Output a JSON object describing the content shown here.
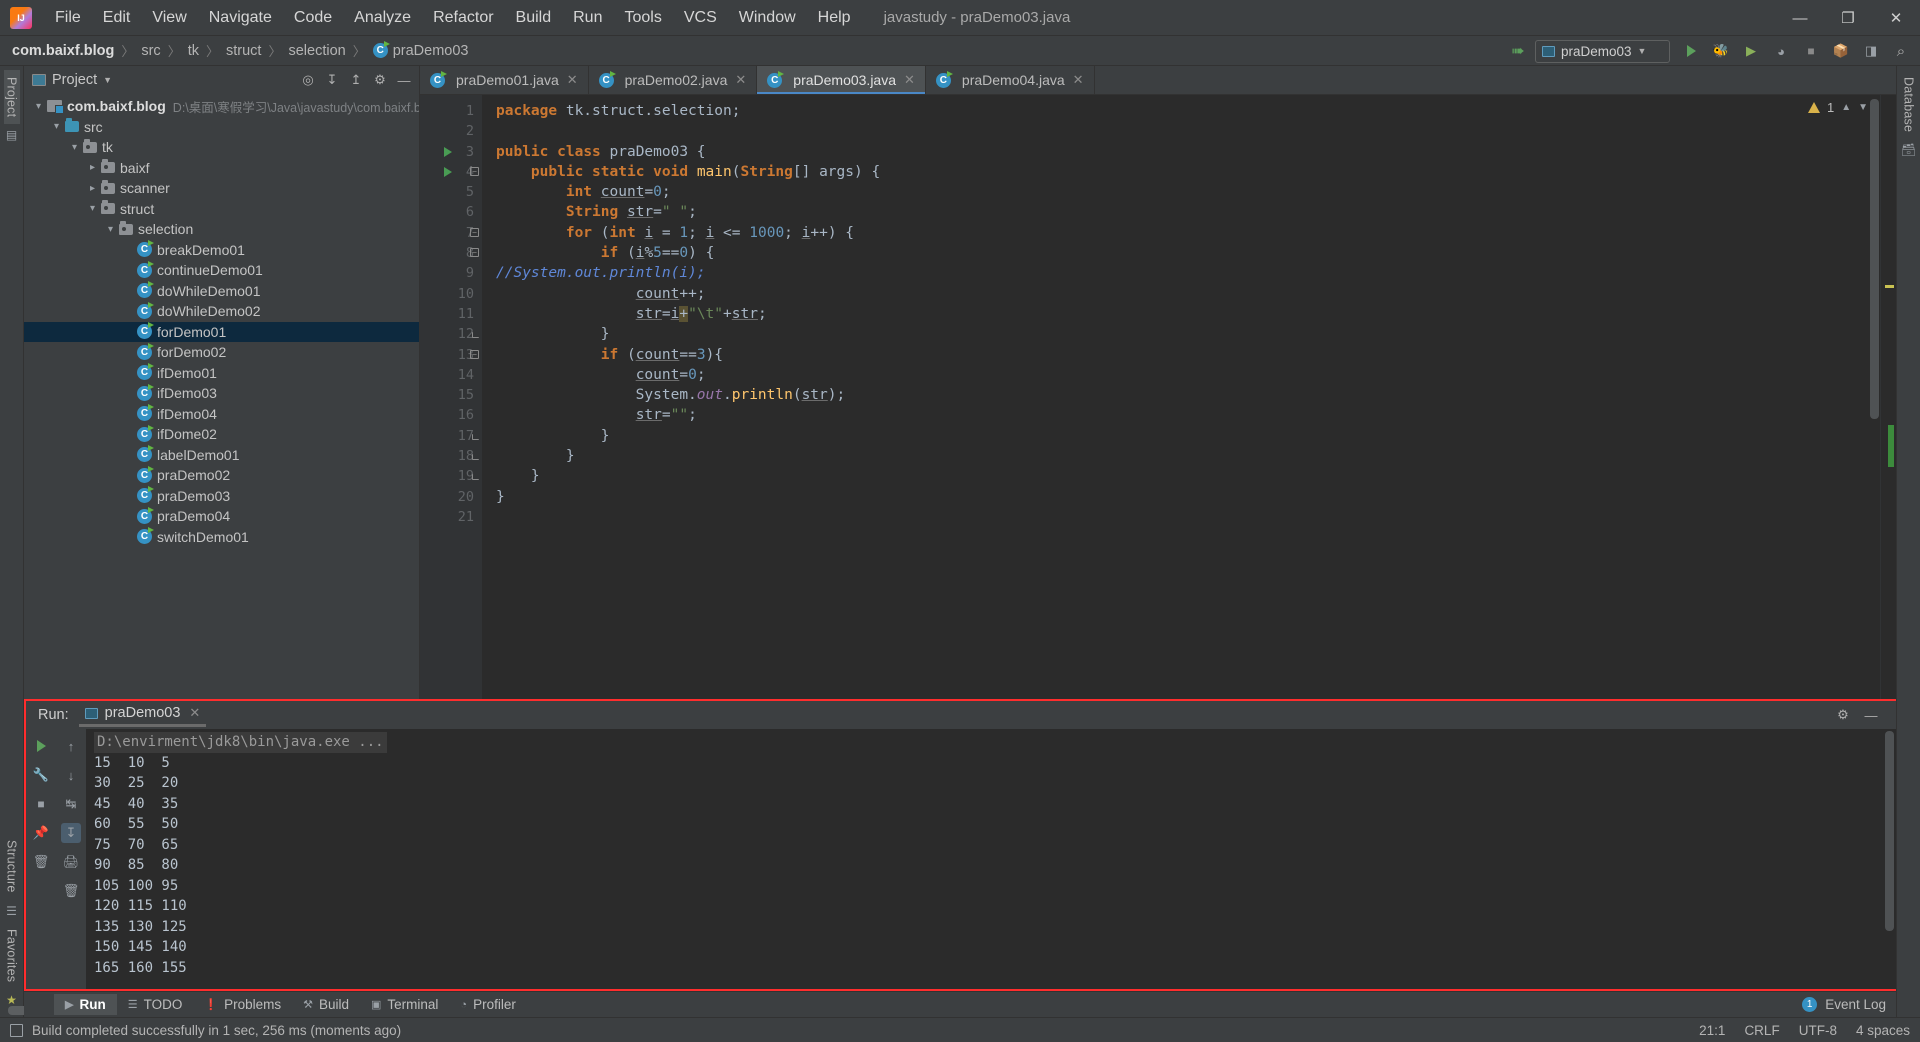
{
  "window": {
    "title": "javastudy - praDemo03.java",
    "controls": {
      "minimize": "—",
      "maximize": "❐",
      "close": "✕"
    }
  },
  "menu": {
    "items": [
      {
        "label": "File"
      },
      {
        "label": "Edit"
      },
      {
        "label": "View"
      },
      {
        "label": "Navigate"
      },
      {
        "label": "Code"
      },
      {
        "label": "Analyze"
      },
      {
        "label": "Refactor"
      },
      {
        "label": "Build"
      },
      {
        "label": "Run"
      },
      {
        "label": "Tools"
      },
      {
        "label": "VCS"
      },
      {
        "label": "Window"
      },
      {
        "label": "Help"
      }
    ]
  },
  "breadcrumb": {
    "items": [
      "com.baixf.blog",
      "src",
      "tk",
      "struct",
      "selection",
      "praDemo03"
    ],
    "separator": "〉"
  },
  "toolbar": {
    "run_config": "praDemo03",
    "hammer_icon": "build-icon",
    "run_icon": "run-icon",
    "debug_icon": "debug-icon",
    "run_coverage_icon": "run-with-coverage-icon",
    "profile_icon": "profile-icon",
    "stop_icon": "stop-icon",
    "updates_icon": "updates-icon",
    "layout_icon": "layout-icon",
    "search_icon": "search-icon"
  },
  "rails": {
    "left_top": [
      "Project"
    ],
    "left_bottom": [
      "Structure",
      "Favorites"
    ],
    "right": [
      "Database"
    ]
  },
  "project_panel": {
    "title": "Project",
    "actions": [
      "locate-icon",
      "expand-all-icon",
      "collapse-all-icon",
      "settings-icon",
      "hide-icon"
    ],
    "tree": [
      {
        "indent": 0,
        "arrow": "⌄",
        "icon": "module",
        "label": "com.baixf.blog",
        "bold": true,
        "path": "D:\\桌面\\寒假学习\\Java\\javastudy\\com.baixf.b",
        "selected": false
      },
      {
        "indent": 1,
        "arrow": "⌄",
        "icon": "src",
        "label": "src",
        "selected": false
      },
      {
        "indent": 2,
        "arrow": "⌄",
        "icon": "pkg",
        "label": "tk",
        "selected": false
      },
      {
        "indent": 3,
        "arrow": "›",
        "icon": "pkg",
        "label": "baixf",
        "selected": false
      },
      {
        "indent": 3,
        "arrow": "›",
        "icon": "pkg",
        "label": "scanner",
        "selected": false
      },
      {
        "indent": 3,
        "arrow": "⌄",
        "icon": "pkg",
        "label": "struct",
        "selected": false
      },
      {
        "indent": 4,
        "arrow": "⌄",
        "icon": "pkg",
        "label": "selection",
        "selected": false
      },
      {
        "indent": 5,
        "arrow": "",
        "icon": "class",
        "label": "breakDemo01",
        "selected": false
      },
      {
        "indent": 5,
        "arrow": "",
        "icon": "class",
        "label": "continueDemo01",
        "selected": false
      },
      {
        "indent": 5,
        "arrow": "",
        "icon": "class",
        "label": "doWhileDemo01",
        "selected": false
      },
      {
        "indent": 5,
        "arrow": "",
        "icon": "class",
        "label": "doWhileDemo02",
        "selected": false
      },
      {
        "indent": 5,
        "arrow": "",
        "icon": "class",
        "label": "forDemo01",
        "selected": true
      },
      {
        "indent": 5,
        "arrow": "",
        "icon": "class",
        "label": "forDemo02",
        "selected": false
      },
      {
        "indent": 5,
        "arrow": "",
        "icon": "class",
        "label": "ifDemo01",
        "selected": false
      },
      {
        "indent": 5,
        "arrow": "",
        "icon": "class",
        "label": "ifDemo03",
        "selected": false
      },
      {
        "indent": 5,
        "arrow": "",
        "icon": "class",
        "label": "ifDemo04",
        "selected": false
      },
      {
        "indent": 5,
        "arrow": "",
        "icon": "class",
        "label": "ifDome02",
        "selected": false
      },
      {
        "indent": 5,
        "arrow": "",
        "icon": "class",
        "label": "labelDemo01",
        "selected": false
      },
      {
        "indent": 5,
        "arrow": "",
        "icon": "class",
        "label": "praDemo02",
        "selected": false
      },
      {
        "indent": 5,
        "arrow": "",
        "icon": "class",
        "label": "praDemo03",
        "selected": false
      },
      {
        "indent": 5,
        "arrow": "",
        "icon": "class",
        "label": "praDemo04",
        "selected": false
      },
      {
        "indent": 5,
        "arrow": "",
        "icon": "class",
        "label": "switchDemo01",
        "selected": false
      }
    ]
  },
  "editor": {
    "tabs": [
      {
        "label": "praDemo01.java",
        "active": false,
        "close": "✕"
      },
      {
        "label": "praDemo02.java",
        "active": false,
        "close": "✕"
      },
      {
        "label": "praDemo03.java",
        "active": true,
        "close": "✕"
      },
      {
        "label": "praDemo04.java",
        "active": false,
        "close": "✕"
      }
    ],
    "inspection": {
      "warning_count": "1",
      "warning_icon": "warning-triangle-icon"
    },
    "line_numbers": [
      1,
      2,
      3,
      4,
      5,
      6,
      7,
      8,
      9,
      10,
      11,
      12,
      13,
      14,
      15,
      16,
      17,
      18,
      19,
      20,
      21
    ],
    "lines": [
      "package tk.struct.selection;",
      "",
      "public class praDemo03 {",
      "    public static void main(String[] args) {",
      "        int count=0;",
      "        String str=\" \";",
      "        for (int i = 1; i <= 1000; i++) {",
      "            if (i%5==0) {",
      "                //System.out.println(i);",
      "                count++;",
      "                str=i+\"\\t\"+str;",
      "            }",
      "            if (count==3){",
      "                count=0;",
      "                System.out.println(str);",
      "                str=\"\";",
      "            }",
      "        }",
      "    }",
      "}",
      ""
    ]
  },
  "run_panel": {
    "label": "Run:",
    "tab_title": "praDemo03",
    "tab_close": "✕",
    "settings_icon": "gear-icon",
    "minimize_icon": "minimize-icon",
    "tools": [
      "rerun-icon",
      "wrench-icon",
      "stop-icon",
      "trash-icon"
    ],
    "tools2": [
      "scroll-up-icon",
      "scroll-down-icon",
      "soft-wrap-icon",
      "scroll-to-end-icon",
      "print-icon",
      "clear-all-icon"
    ],
    "command_line": "D:\\envirment\\jdk8\\bin\\java.exe ...",
    "output": [
      "15  10  5",
      "30  25  20",
      "45  40  35",
      "60  55  50",
      "75  70  65",
      "90  85  80",
      "105 100 95",
      "120 115 110",
      "135 130 125",
      "150 145 140",
      "165 160 155"
    ]
  },
  "bottom_tabs": {
    "items": [
      {
        "label": "Run",
        "icon": "run-icon",
        "active": true
      },
      {
        "label": "TODO",
        "icon": "todo-icon",
        "active": false
      },
      {
        "label": "Problems",
        "icon": "problems-icon",
        "active": false
      },
      {
        "label": "Build",
        "icon": "build-icon",
        "active": false
      },
      {
        "label": "Terminal",
        "icon": "terminal-icon",
        "active": false
      },
      {
        "label": "Profiler",
        "icon": "profiler-icon",
        "active": false
      }
    ],
    "event_log": {
      "count": "1",
      "label": "Event Log"
    }
  },
  "statusbar": {
    "message": "Build completed successfully in 1 sec, 256 ms (moments ago)",
    "caret_position": "21:1",
    "line_separator": "CRLF",
    "encoding": "UTF-8",
    "indent": "4 spaces"
  },
  "colors": {
    "accent_blue": "#4a88c7",
    "selection": "#0d293e",
    "highlight_red": "#ff2d2d",
    "keyword": "#cc7832",
    "string": "#6a8759",
    "number": "#6897bb",
    "comment": "#5f87d7",
    "method": "#ffc66d"
  }
}
